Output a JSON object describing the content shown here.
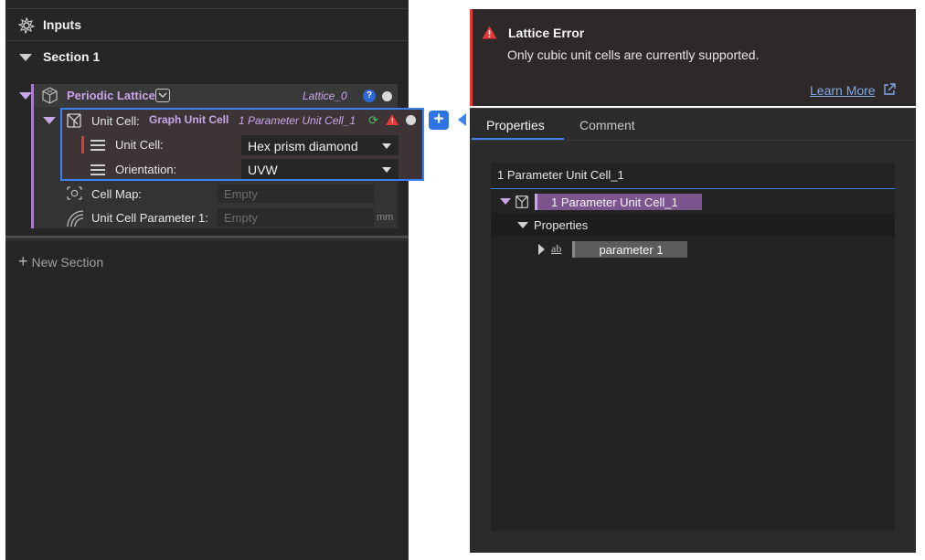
{
  "inputs": {
    "title": "Inputs"
  },
  "section": {
    "title": "Section 1"
  },
  "lattice": {
    "title": "Periodic Lattice",
    "name": "Lattice_0",
    "help": "?"
  },
  "unit_cell": {
    "label": "Unit Cell:",
    "type": "Graph Unit Cell",
    "name": "1 Parameter Unit Cell_1",
    "sub_unit_cell_label": "Unit Cell:",
    "sub_unit_cell_value": "Hex prism diamond",
    "orientation_label": "Orientation:",
    "orientation_value": "UVW"
  },
  "cell_map": {
    "label": "Cell Map:",
    "placeholder": "Empty"
  },
  "unit_cell_param": {
    "label": "Unit Cell Parameter 1:",
    "placeholder": "Empty",
    "unit": "mm"
  },
  "new_section": {
    "label": "New Section"
  },
  "error": {
    "title": "Lattice Error",
    "message": "Only cubic unit cells are currently supported.",
    "learn_more": "Learn More"
  },
  "tabs": [
    {
      "label": "Properties"
    },
    {
      "label": "Comment"
    }
  ],
  "tree": {
    "title": "1 Parameter Unit Cell_1",
    "node": "1 Parameter Unit Cell_1",
    "properties": "Properties",
    "param_icon": "ab",
    "param": "parameter 1"
  },
  "colors": {
    "accent": "#3d82f0",
    "error": "#e53935",
    "lattice": "#c9a5ea"
  }
}
